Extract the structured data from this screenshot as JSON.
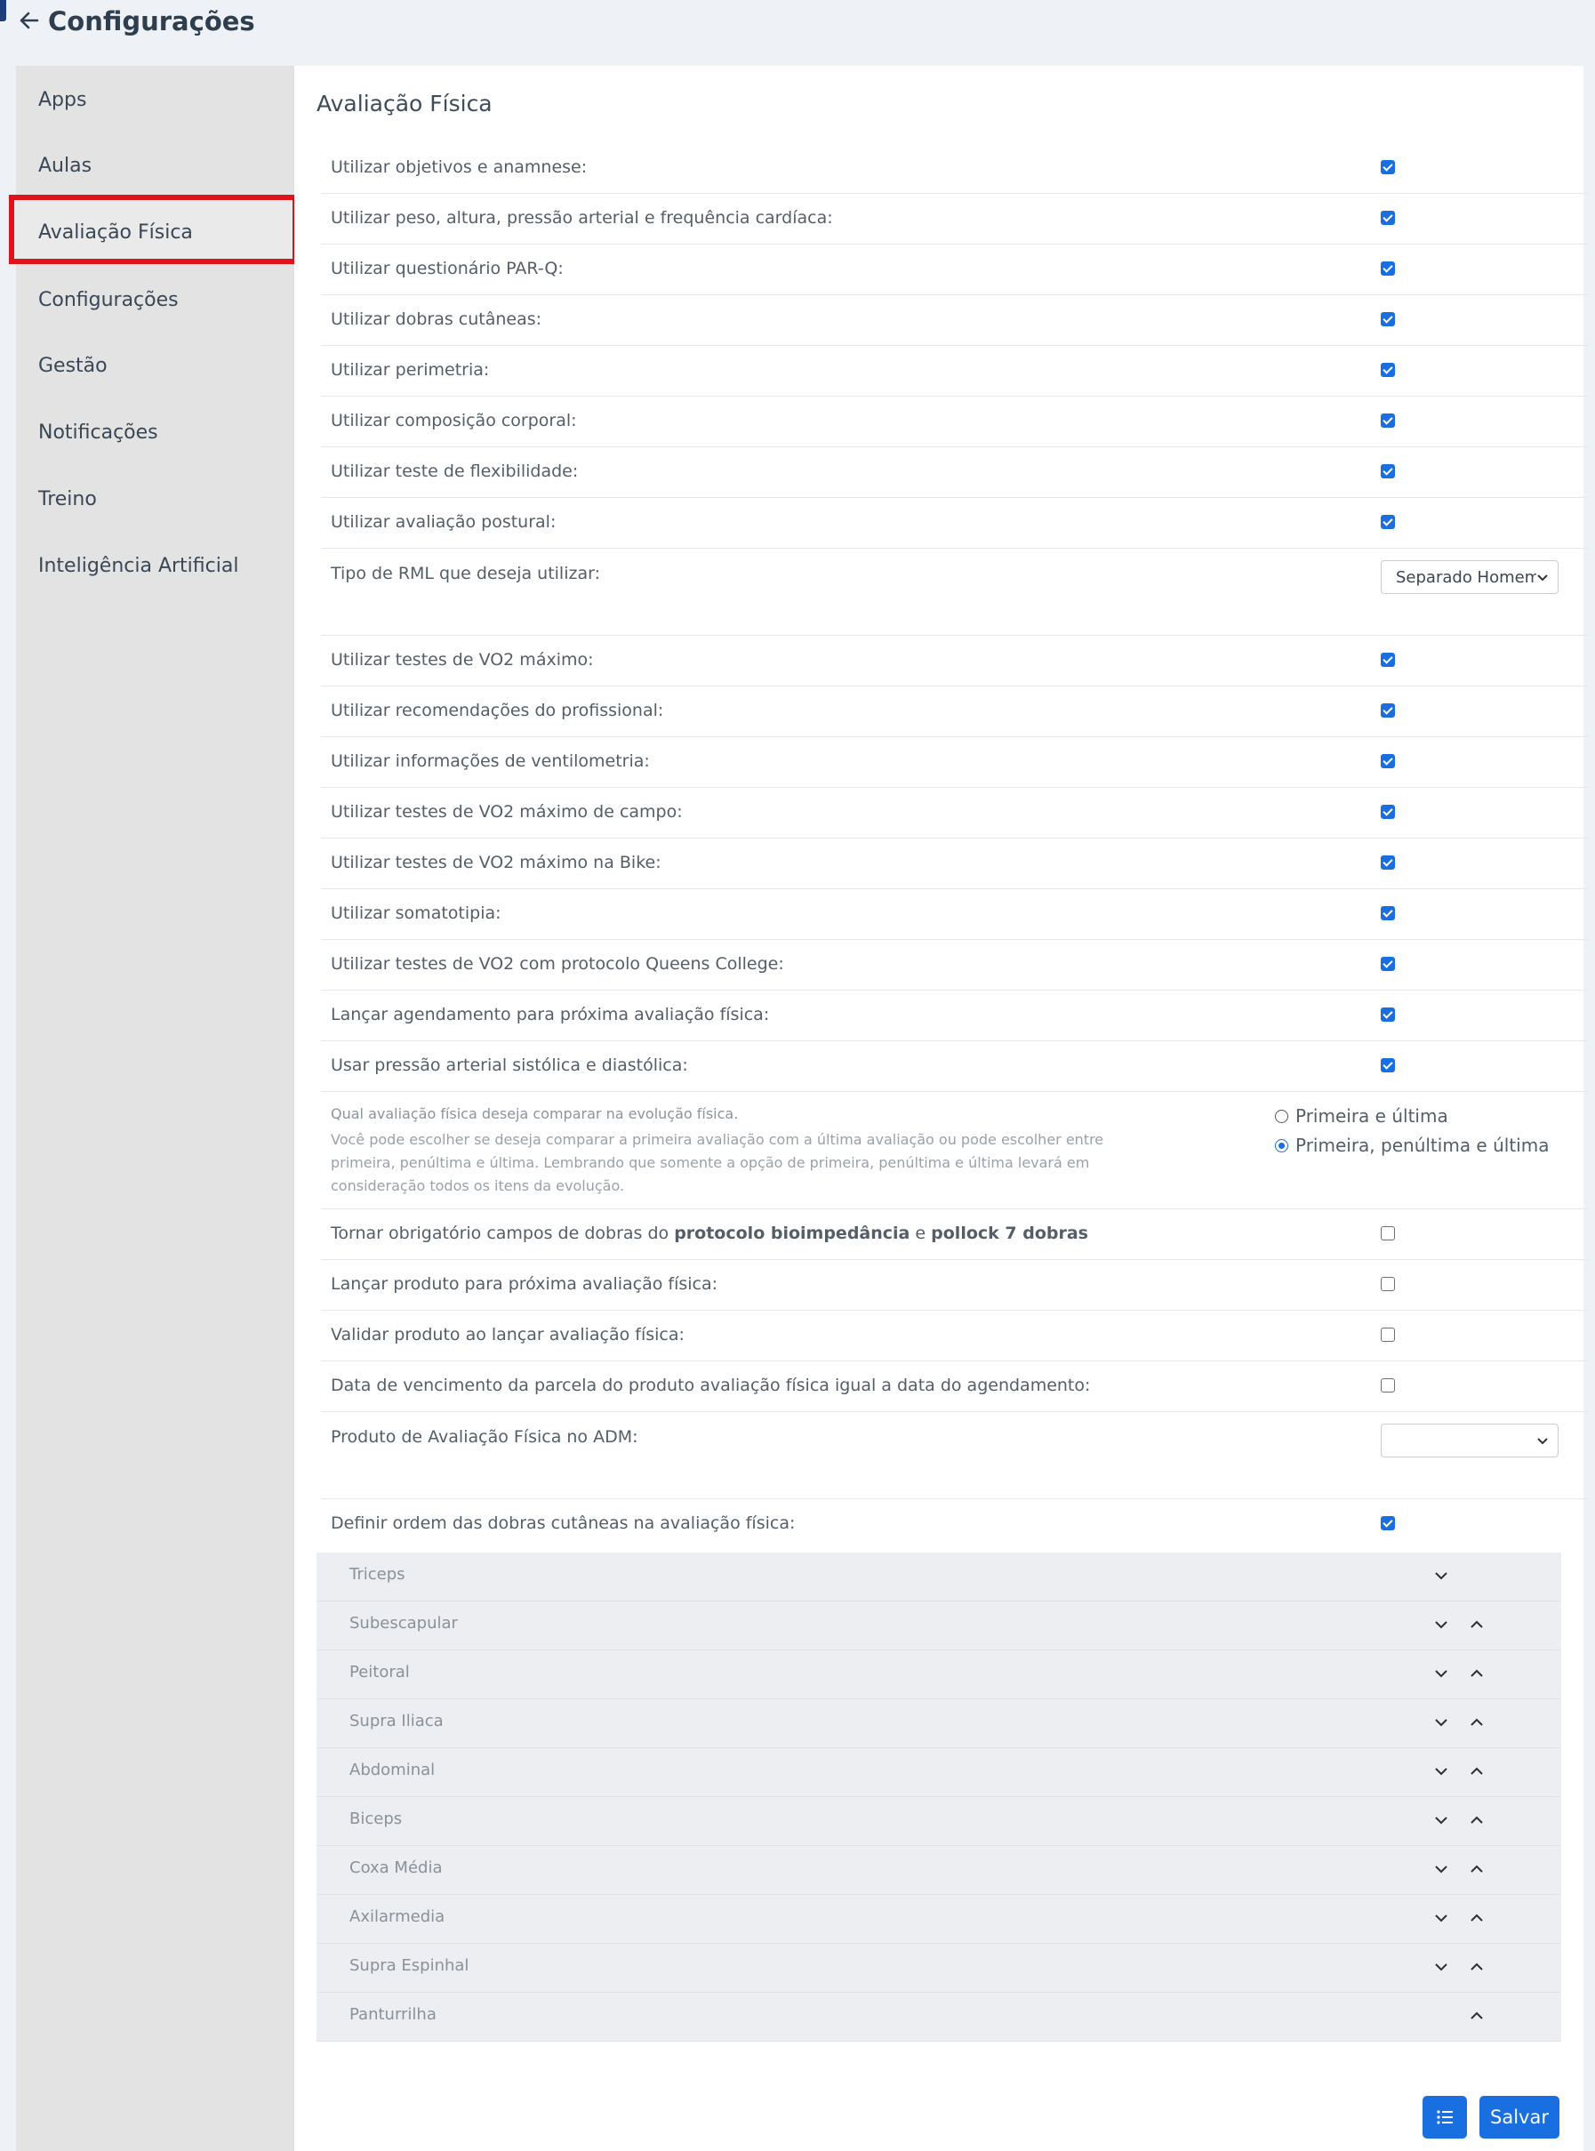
{
  "header": {
    "title": "Configurações",
    "back_icon": "arrow-left-icon"
  },
  "sidebar": {
    "items": [
      {
        "label": "Apps"
      },
      {
        "label": "Aulas"
      },
      {
        "label": "Avaliação Física",
        "active": true
      },
      {
        "label": "Configurações"
      },
      {
        "label": "Gestão"
      },
      {
        "label": "Notificações"
      },
      {
        "label": "Treino"
      },
      {
        "label": "Inteligência Artificial"
      }
    ],
    "highlight_color": "#e0121a"
  },
  "main": {
    "section_title": "Avaliação Física",
    "options1": [
      {
        "label": "Utilizar objetivos e anamnese:",
        "checked": true
      },
      {
        "label": "Utilizar peso, altura, pressão arterial e frequência cardíaca:",
        "checked": true
      },
      {
        "label": "Utilizar questionário PAR-Q:",
        "checked": true
      },
      {
        "label": "Utilizar dobras cutâneas:",
        "checked": true
      },
      {
        "label": "Utilizar perimetria:",
        "checked": true
      },
      {
        "label": "Utilizar composição corporal:",
        "checked": true
      },
      {
        "label": "Utilizar teste de flexibilidade:",
        "checked": true
      },
      {
        "label": "Utilizar avaliação postural:",
        "checked": true
      }
    ],
    "rml": {
      "label": "Tipo de RML que deseja utilizar:",
      "value": "Separado Homem/"
    },
    "options2": [
      {
        "label": "Utilizar testes de VO2 máximo:",
        "checked": true
      },
      {
        "label": "Utilizar recomendações do profissional:",
        "checked": true
      },
      {
        "label": "Utilizar informações de ventilometria:",
        "checked": true
      },
      {
        "label": "Utilizar testes de VO2 máximo de campo:",
        "checked": true
      },
      {
        "label": "Utilizar testes de VO2 máximo na Bike:",
        "checked": true
      },
      {
        "label": "Utilizar somatotipia:",
        "checked": true
      },
      {
        "label": "Utilizar testes de VO2 com protocolo Queens College:",
        "checked": true
      },
      {
        "label": "Lançar agendamento para próxima avaliação física:",
        "checked": true
      },
      {
        "label": "Usar pressão arterial sistólica e diastólica:",
        "checked": true
      }
    ],
    "compare": {
      "title": "Qual avaliação física deseja comparar na evolução física.",
      "help": "Você pode escolher se deseja comparar a primeira avaliação com a última avaliação ou pode escolher entre primeira, penúltima e última. Lembrando que somente a opção de primeira, penúltima e última levará em consideração todos os itens da evolução.",
      "option_a": "Primeira e última",
      "option_b": "Primeira, penúltima e última",
      "selected": "option_b"
    },
    "mandatory": {
      "prefix": "Tornar obrigatório campos de dobras do ",
      "bold1": "protocolo bioimpedância",
      "mid": " e ",
      "bold2": "pollock 7 dobras",
      "checked": false
    },
    "options3": [
      {
        "label": "Lançar produto para próxima avaliação física:",
        "checked": false
      },
      {
        "label": "Validar produto ao lançar avaliação física:",
        "checked": false
      },
      {
        "label": "Data de vencimento da parcela do produto avaliação física igual a data do agendamento:",
        "checked": false
      }
    ],
    "product": {
      "label": "Produto de Avaliação Física no ADM:",
      "value": ""
    },
    "order": {
      "label": "Definir ordem das dobras cutâneas na avaliação física:",
      "checked": true
    },
    "folds": [
      {
        "label": "Triceps",
        "down": true,
        "up": false
      },
      {
        "label": "Subescapular",
        "down": true,
        "up": true
      },
      {
        "label": "Peitoral",
        "down": true,
        "up": true
      },
      {
        "label": "Supra Iliaca",
        "down": true,
        "up": true
      },
      {
        "label": "Abdominal",
        "down": true,
        "up": true
      },
      {
        "label": "Biceps",
        "down": true,
        "up": true
      },
      {
        "label": "Coxa Média",
        "down": true,
        "up": true
      },
      {
        "label": "Axilarmedia",
        "down": true,
        "up": true
      },
      {
        "label": "Supra Espinhal",
        "down": true,
        "up": true
      },
      {
        "label": "Panturrilha",
        "down": false,
        "up": true
      }
    ]
  },
  "footer": {
    "list_icon": "list-icon",
    "save_label": "Salvar"
  },
  "colors": {
    "accent": "#1a6fe0",
    "sidebar": "#e3e3e3",
    "background": "#eef2f6"
  }
}
